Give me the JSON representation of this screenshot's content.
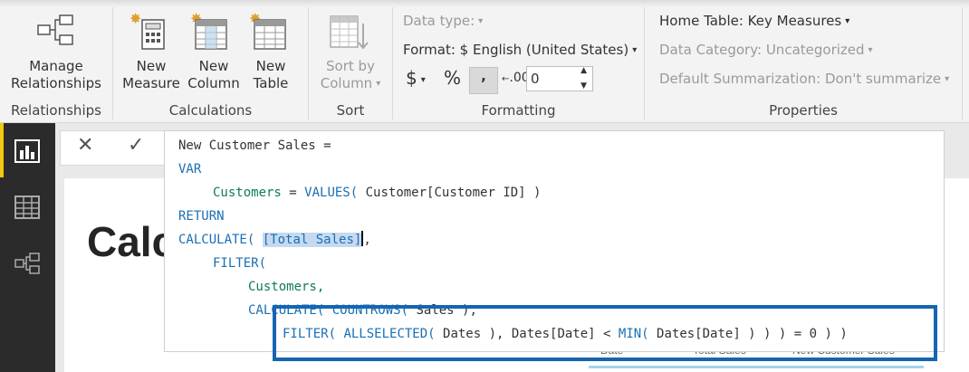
{
  "ribbon": {
    "relationships": {
      "manage_line1": "Manage",
      "manage_line2": "Relationships",
      "group_label": "Relationships"
    },
    "calculations": {
      "new_measure_line1": "New",
      "new_measure_line2": "Measure",
      "new_column_line1": "New",
      "new_column_line2": "Column",
      "new_table_line1": "New",
      "new_table_line2": "Table",
      "group_label": "Calculations"
    },
    "sort": {
      "sort_by_line1": "Sort by",
      "sort_by_line2": "Column",
      "group_label": "Sort"
    },
    "formatting": {
      "data_type": "Data type:",
      "format": "Format: $ English (United States)",
      "currency_symbol": "$",
      "percent_symbol": "%",
      "comma_symbol": ",",
      "decimal_symbol": ".00",
      "decimal_places": "0",
      "group_label": "Formatting"
    },
    "properties": {
      "home_table": "Home Table: Key Measures",
      "data_category": "Data Category: Uncategorized",
      "default_summarization": "Default Summarization: Don't summarize",
      "group_label": "Properties"
    }
  },
  "formula_bar": {
    "cancel_symbol": "✕",
    "commit_symbol": "✓"
  },
  "editor": {
    "line1": "New Customer Sales =",
    "line2": "VAR",
    "line3_var": "Customers",
    "line3_eq": " = ",
    "line3_fn": "VALUES(",
    "line3_rest": " Customer[Customer ID] )",
    "line4": "RETURN",
    "line5_fn": "CALCULATE(",
    "line5_sel": "[Total Sales]",
    "line5_end": ",",
    "line6": "FILTER(",
    "line7": "Customers,",
    "line8_a": "CALCULATE(",
    "line8_b": " COUNTROWS(",
    "line8_c": " Sales ),",
    "line9_fn1": "FILTER(",
    "line9_fn2": " ALLSELECTED(",
    "line9_mid": " Dates ), Dates[Date] < ",
    "line9_fn3": "MIN(",
    "line9_end": " Dates[Date] ) ) ) = 0 ) )"
  },
  "canvas": {
    "title_partial": "Calc",
    "table_headers": [
      "Date",
      "Total Sales",
      "New Customer Sales"
    ]
  },
  "colors": {
    "keyword": "#1a6fb3",
    "variable": "#0f7a5e",
    "highlight_box": "#1565b2",
    "nav_active": "#f2c811"
  }
}
